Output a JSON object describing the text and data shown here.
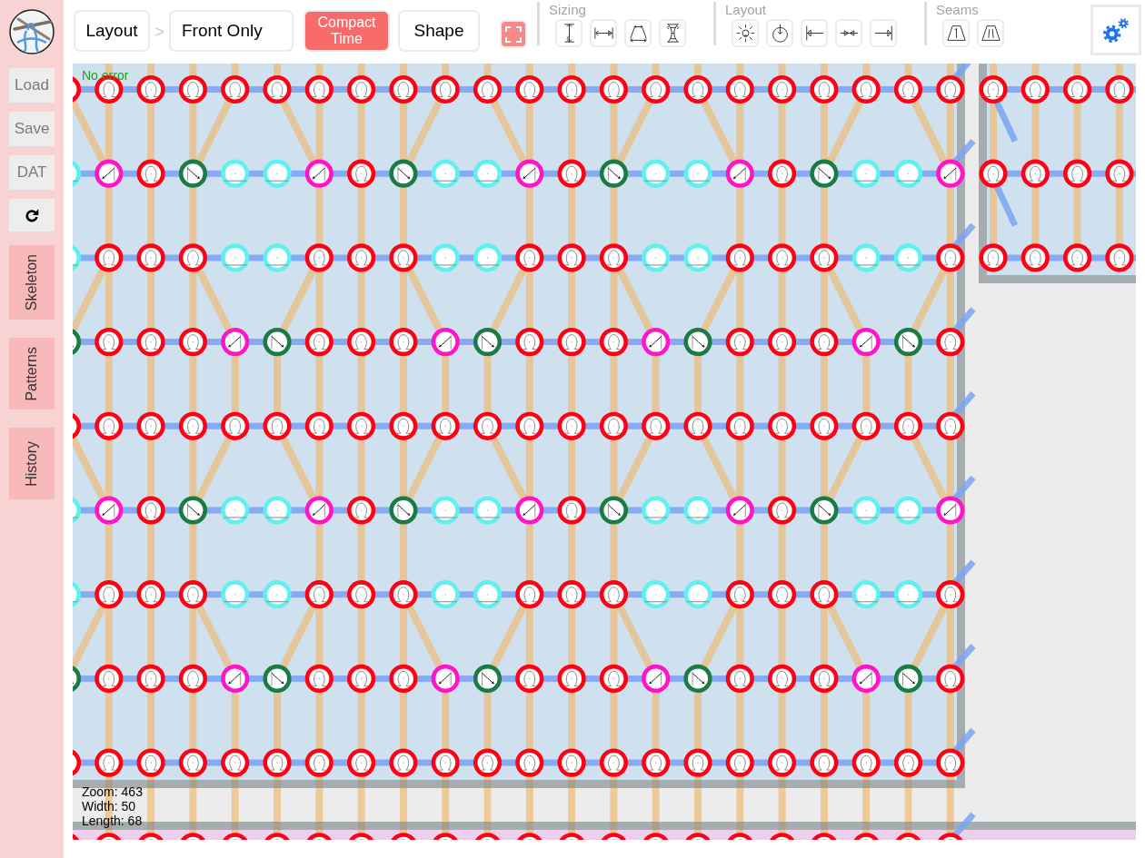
{
  "sidebar": {
    "actions": [
      {
        "label": "Load"
      },
      {
        "label": "Save"
      },
      {
        "label": "DAT"
      }
    ],
    "panels": [
      {
        "label": "Skeleton"
      },
      {
        "label": "Patterns"
      },
      {
        "label": "History"
      }
    ]
  },
  "toolbar": {
    "items": [
      {
        "kind": "button",
        "label": "Layout",
        "on": false
      },
      {
        "kind": "separator",
        "label": ">"
      },
      {
        "kind": "button",
        "label": "Front Only",
        "on": false
      },
      {
        "kind": "button",
        "label": "Compact Time",
        "on": true
      },
      {
        "kind": "button",
        "label": "Shape",
        "on": false
      }
    ],
    "groups": [
      {
        "title": "Sizing",
        "tools": [
          {
            "kind": "height"
          },
          {
            "kind": "width"
          },
          {
            "kind": "flare"
          },
          {
            "kind": "pinch"
          }
        ]
      },
      {
        "title": "Layout",
        "tools": [
          {
            "kind": "sun"
          },
          {
            "kind": "drop"
          },
          {
            "kind": "left"
          },
          {
            "kind": "middle"
          },
          {
            "kind": "right"
          }
        ]
      },
      {
        "title": "Seams",
        "tools": [
          {
            "kind": "single"
          },
          {
            "kind": "double"
          }
        ]
      }
    ]
  },
  "canvas": {
    "status": "No error",
    "stats": [
      "Zoom: 463",
      "Width: 50",
      "Length: 68"
    ]
  }
}
